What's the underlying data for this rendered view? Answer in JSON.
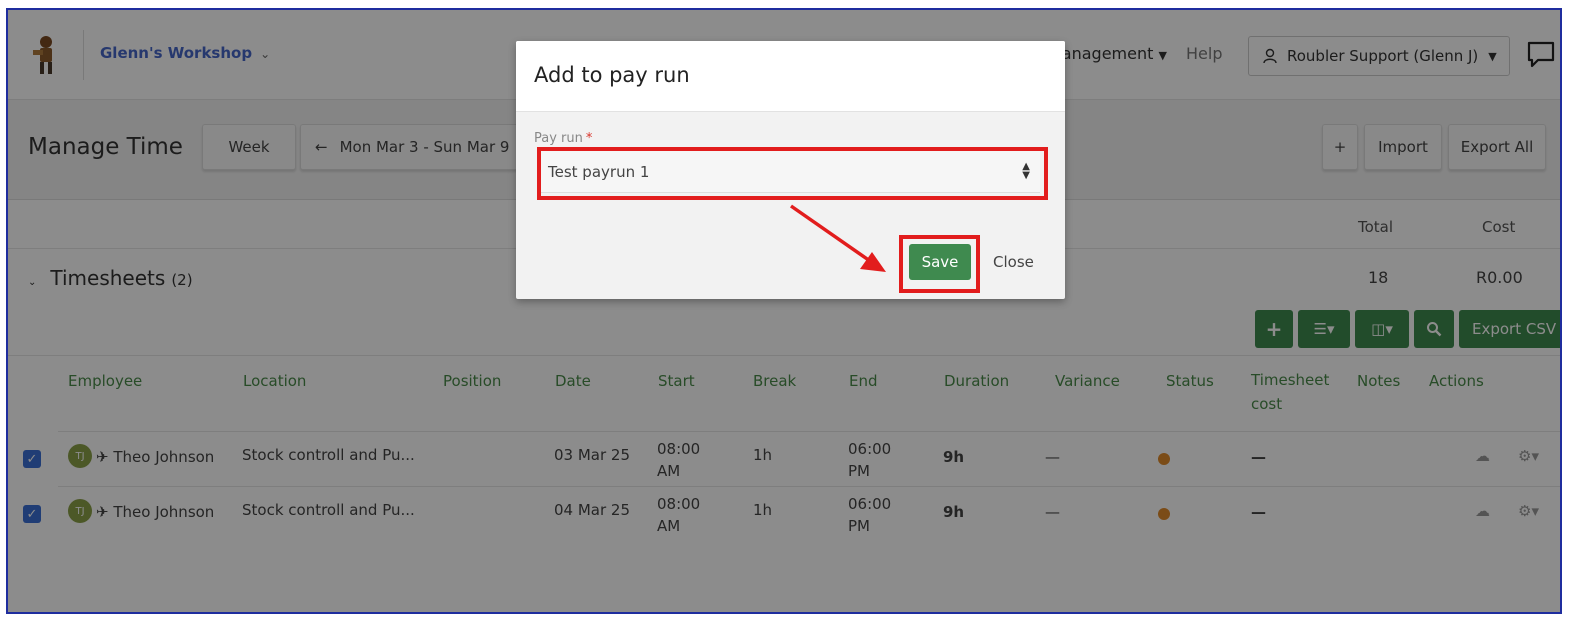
{
  "app": {
    "workspace": "Glenn's Workshop",
    "nav_management": "Management",
    "nav_help": "Help",
    "user": "Roubler Support (Glenn J)"
  },
  "header": {
    "title": "Manage Time",
    "view_button": "Week",
    "date_range": "Mon Mar 3 - Sun Mar 9",
    "add_button": "+",
    "import_button": "Import",
    "export_all_button": "Export All"
  },
  "summary": {
    "total_label": "Total",
    "cost_label": "Cost",
    "section_title": "Timesheets",
    "section_count": "(2)",
    "total_value": "18",
    "cost_value": "R0.00"
  },
  "toolbar": {
    "export_csv": "Export CSV"
  },
  "table": {
    "columns": [
      "Employee",
      "Location",
      "Position",
      "Date",
      "Start",
      "Break",
      "End",
      "Duration",
      "Variance",
      "Status",
      "Timesheet cost",
      "Notes",
      "Actions"
    ],
    "rows": [
      {
        "initials": "TJ",
        "employee": "Theo Johnson",
        "location": "Stock controll and Pu...",
        "date": "03 Mar 25",
        "start": "08:00 AM",
        "break": "1h",
        "end": "06:00 PM",
        "duration": "9h",
        "variance": "—",
        "cost": "—"
      },
      {
        "initials": "TJ",
        "employee": "Theo Johnson",
        "location": "Stock controll and Pu...",
        "date": "04 Mar 25",
        "start": "08:00 AM",
        "break": "1h",
        "end": "06:00 PM",
        "duration": "9h",
        "variance": "—",
        "cost": "—"
      }
    ]
  },
  "modal": {
    "title": "Add to pay run",
    "field_label": "Pay run",
    "required_mark": "*",
    "selected_value": "Test payrun 1",
    "save_label": "Save",
    "close_label": "Close"
  },
  "colors": {
    "accent_green": "#3f8a4f",
    "highlight_red": "#e21d1d",
    "brand_blue": "#4666c8",
    "status_orange": "#e08a2a"
  }
}
